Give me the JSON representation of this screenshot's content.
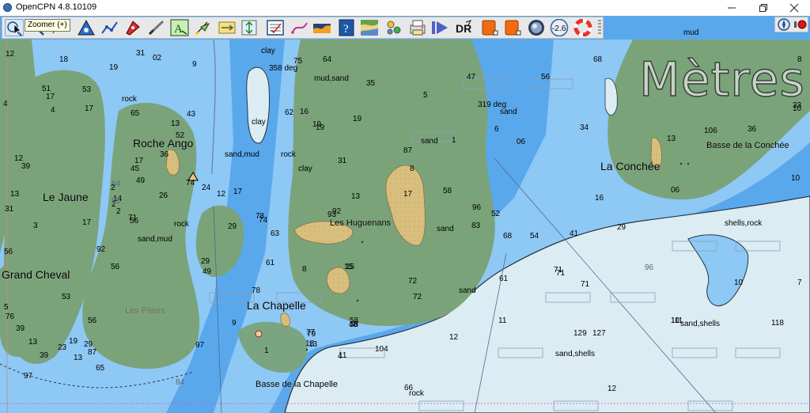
{
  "window": {
    "title": "OpenCPN 4.8.10109",
    "controls": [
      "minimize-icon",
      "restore-icon",
      "close-icon"
    ]
  },
  "toolbar": {
    "tooltip": "Zoomer (+)",
    "tools": [
      {
        "name": "zoom-in-icon",
        "active": true
      },
      {
        "name": "zoom-out-icon"
      },
      {
        "name": "route-icon"
      },
      {
        "name": "triangle-waypoint-icon"
      },
      {
        "name": "polyline-route-icon"
      },
      {
        "name": "boat-icon"
      },
      {
        "name": "measure-tool-icon"
      },
      {
        "name": "text-annotation-icon"
      },
      {
        "name": "waypoint-flag-icon"
      },
      {
        "name": "tide-arrows-icon"
      },
      {
        "name": "elevation-icon"
      },
      {
        "name": "checklist-icon"
      },
      {
        "name": "track-icon"
      },
      {
        "name": "chart-bar-icon"
      },
      {
        "name": "help-book-icon"
      },
      {
        "name": "chart-quilt-icon"
      },
      {
        "name": "layers-icon"
      },
      {
        "name": "print-icon"
      },
      {
        "name": "play-forward-icon"
      },
      {
        "name": "dead-reckoning-icon",
        "text": "DR"
      },
      {
        "name": "orange-square-icon"
      },
      {
        "name": "orange-square-alt-icon"
      },
      {
        "name": "globe-icon"
      },
      {
        "name": "depth-offset-icon",
        "text": "-2.6"
      },
      {
        "name": "lifebuoy-icon"
      }
    ]
  },
  "status": {
    "compass_icon": "compass-icon",
    "gps_icon": "gps-status-icon"
  },
  "chart": {
    "units_label": "Mètres",
    "colors": {
      "deep": "#5aa8ec",
      "medium": "#8ec8f5",
      "shallow": "#dbedf3",
      "land": "#7aa37a",
      "dry": "#d9bf7e"
    },
    "places": {
      "roche_ango": "Roche Ango",
      "le_jaune": "Le Jaune",
      "grand_cheval": "Grand Cheval",
      "la_chapelle": "La Chapelle",
      "les_huguenans": "Les Huguenans",
      "la_conchee": "La Conchée",
      "basse_conchee": "Basse de la Conchée",
      "basse_chapelle": "Basse de la Chapelle",
      "les_piliers": "Les Piliers"
    },
    "bearings": {
      "b1": "358 deg",
      "b2": "319 deg"
    },
    "seabed": {
      "clay1": "clay",
      "clay2": "clay",
      "clay3": "clay",
      "mud_sand": "mud,sand",
      "sand_mud1": "sand,mud",
      "sand_mud2": "sand,mud",
      "sand1": "sand",
      "sand2": "sand",
      "sand3": "sand",
      "sand4": "sand",
      "rock1": "rock",
      "rock2": "rock",
      "rock3": "rock",
      "rock4": "rock",
      "shells_rock": "shells,rock",
      "sand_shells1": "sand,shells",
      "sand_shells2": "sand,shells",
      "mud": "mud"
    },
    "soundings": [
      "31",
      "02",
      "19",
      "9",
      "75",
      "64",
      "68",
      "18",
      "12",
      "17",
      "53",
      "65",
      "62",
      "19",
      "19",
      "16",
      "6",
      "92",
      "8",
      "2",
      "56",
      "87",
      "34",
      "16",
      "33",
      "36",
      "10",
      "39",
      "17",
      "36",
      "74",
      "2",
      "26",
      "12",
      "17",
      "45",
      "3",
      "14",
      "49",
      "84",
      "13",
      "31",
      "17",
      "56",
      "53",
      "24",
      "93",
      "83",
      "58",
      "52",
      "96",
      "31",
      "13",
      "74",
      "29",
      "78",
      "63",
      "68",
      "54",
      "41",
      "29",
      "71",
      "8",
      "15",
      "72",
      "96",
      "58",
      "29",
      "49",
      "56",
      "29",
      "39",
      "13",
      "23",
      "39",
      "71",
      "61",
      "56",
      "92",
      "11",
      "10",
      "72",
      "84",
      "81",
      "71",
      "71",
      "61",
      "9",
      "129",
      "11",
      "118",
      "12",
      "10",
      "7",
      "12",
      "97",
      "19",
      "18",
      "5",
      "78",
      "79",
      "76",
      "104",
      "4",
      "13",
      "106",
      "13",
      "10",
      "51",
      "48",
      "111",
      "13",
      "77",
      "1",
      "17",
      "97",
      "127",
      "66",
      "8",
      "15",
      "2",
      "19",
      "58",
      "65",
      "87",
      "4",
      "12",
      "13",
      "43",
      "17",
      "4",
      "52",
      "56",
      "35",
      "5",
      "47",
      "1",
      "06",
      "06",
      "11"
    ]
  }
}
